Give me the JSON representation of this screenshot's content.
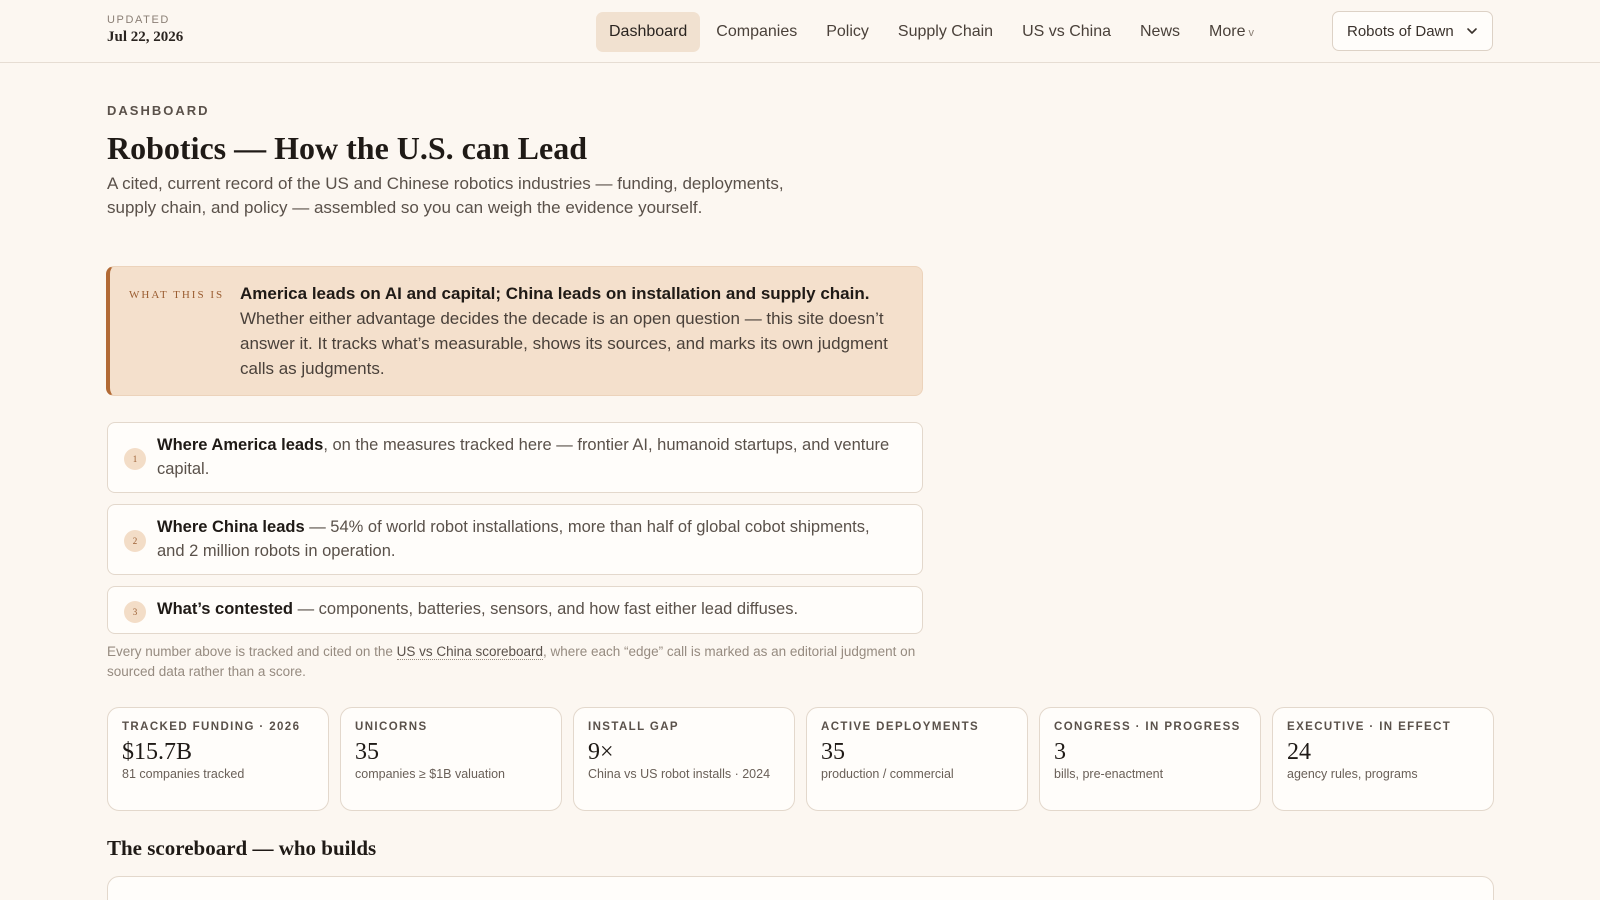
{
  "header": {
    "updated_label": "UPDATED",
    "updated_date": "Jul 22, 2026",
    "nav": [
      {
        "label": "Dashboard",
        "active": true
      },
      {
        "label": "Companies"
      },
      {
        "label": "Policy"
      },
      {
        "label": "Supply Chain"
      },
      {
        "label": "US vs China"
      },
      {
        "label": "News"
      },
      {
        "label": "More"
      }
    ],
    "site_select": "Robots of Dawn"
  },
  "main": {
    "eyebrow": "DASHBOARD",
    "title": "Robotics — How the U.S. can Lead",
    "subtitle": "A cited, current record of the US and Chinese robotics industries — funding, deployments, supply chain, and policy — assembled so you can weigh the evidence yourself.",
    "callout": {
      "label": "WHAT THIS IS",
      "headline": "America leads on AI and capital; China leads on installation and supply chain.",
      "body": " Whether either advantage decides the decade is an open question — this site doesn’t answer it. It tracks what’s measurable, shows its sources, and marks its own judgment calls as judgments."
    },
    "points": [
      {
        "num": "1",
        "lead": "Where America leads",
        "text": ", on the measures tracked here — frontier AI, humanoid startups, and venture capital."
      },
      {
        "num": "2",
        "lead": "Where China leads",
        "text": " — 54% of world robot installations, more than half of global cobot shipments, and 2 million robots in operation."
      },
      {
        "num": "3",
        "lead": "What’s contested",
        "text": " — components, batteries, sensors, and how fast either lead diffuses."
      }
    ],
    "footnote": {
      "before": "Every number above is tracked and cited on the ",
      "link": "US vs China scoreboard",
      "after": ", where each “edge” call is marked as an editorial judgment on sourced data rather than a score."
    },
    "stats": [
      {
        "label": "TRACKED FUNDING · 2026",
        "value": "$15.7B",
        "sub": "81 companies tracked"
      },
      {
        "label": "UNICORNS",
        "value": "35",
        "sub": "companies ≥ $1B valuation"
      },
      {
        "label": "INSTALL GAP",
        "value": "9×",
        "sub": "China vs US robot installs · 2024"
      },
      {
        "label": "ACTIVE DEPLOYMENTS",
        "value": "35",
        "sub": "production / commercial"
      },
      {
        "label": "CONGRESS · IN PROGRESS",
        "value": "3",
        "sub": "bills, pre-enactment"
      },
      {
        "label": "EXECUTIVE · IN EFFECT",
        "value": "24",
        "sub": "agency rules, programs"
      }
    ],
    "section_title": "The scoreboard — who builds"
  },
  "colors": {
    "background": "#fcf7f1",
    "accent": "#b26a35",
    "callout_bg": "#f4e0cc",
    "active_nav_bg": "#f1e1d0"
  },
  "icons": {
    "select_chevron": "chevron-down-icon",
    "more_caret": "caret-down-icon"
  }
}
